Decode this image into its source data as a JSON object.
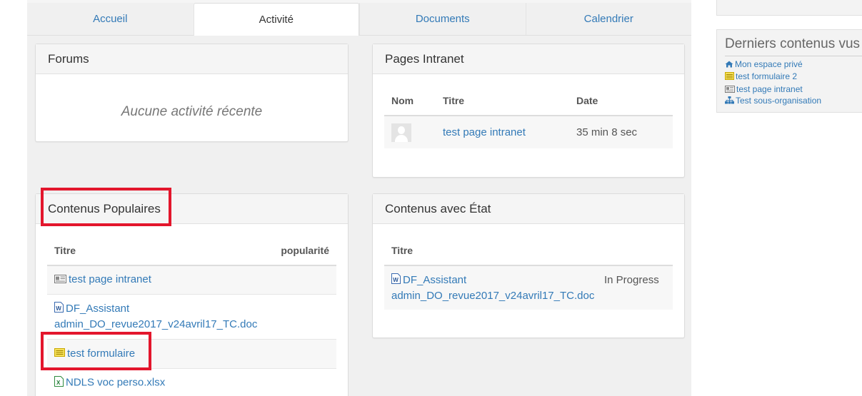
{
  "tabs": [
    {
      "label": "Accueil"
    },
    {
      "label": "Activité"
    },
    {
      "label": "Documents"
    },
    {
      "label": "Calendrier"
    }
  ],
  "forums": {
    "title": "Forums",
    "empty": "Aucune activité récente"
  },
  "pages_intranet": {
    "title": "Pages Intranet",
    "columns": [
      "Nom",
      "Titre",
      "Date"
    ],
    "rows": [
      {
        "title": "test page intranet",
        "date": "35 min 8 sec"
      }
    ]
  },
  "contenus_populaires": {
    "title": "Contenus Populaires",
    "columns": [
      "Titre",
      "popularité"
    ],
    "rows": [
      {
        "title": "test page intranet",
        "icon": "intranet-page-icon"
      },
      {
        "title_line1": "DF_Assistant",
        "title_line2": "admin_DO_revue2017_v24avril17_TC.doc",
        "icon": "word-doc-icon"
      },
      {
        "title": "test formulaire",
        "icon": "form-icon"
      },
      {
        "title": "NDLS voc perso.xlsx",
        "icon": "excel-icon"
      }
    ]
  },
  "contenus_etat": {
    "title": "Contenus avec État",
    "columns": [
      "Titre"
    ],
    "rows": [
      {
        "title_line1": "DF_Assistant",
        "title_line2": "admin_DO_revue2017_v24avril17_TC.doc",
        "state": "In Progress",
        "icon": "word-doc-icon"
      }
    ]
  },
  "sidebar": {
    "title": "Derniers contenus vus",
    "items": [
      {
        "label": "Mon espace privé",
        "icon": "home-icon"
      },
      {
        "label": "test formulaire 2",
        "icon": "form-icon"
      },
      {
        "label": "test page intranet",
        "icon": "intranet-page-icon"
      },
      {
        "label": "Test sous-organisation",
        "icon": "org-chart-icon"
      }
    ]
  },
  "colors": {
    "link": "#337ab7",
    "highlight_box": "#e3162c",
    "panel_header": "#f5f5f5"
  }
}
